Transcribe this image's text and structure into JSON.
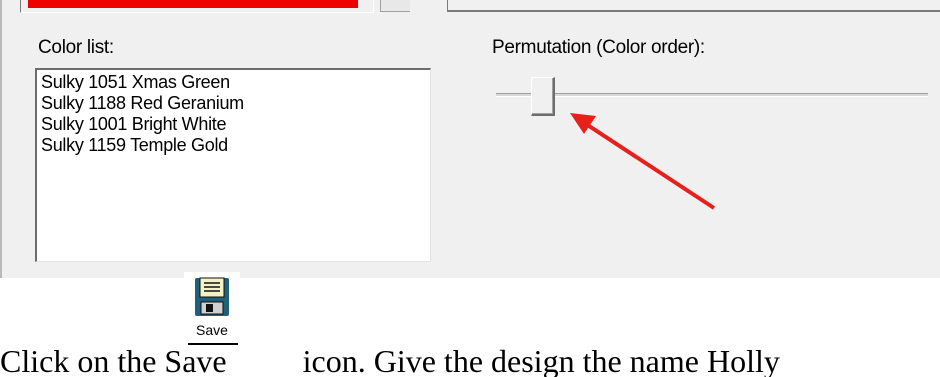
{
  "dialog": {
    "color_list_label": "Color list:",
    "color_list_items": [
      "Sulky 1051 Xmas Green",
      "Sulky 1188 Red Geranium",
      "Sulky 1001 Bright White",
      "Sulky 1159 Temple Gold"
    ],
    "permutation_label": "Permutation (Color order):",
    "permutation_slider_value": 0.1,
    "swatch_color": "#ee0000"
  },
  "annotation": {
    "arrow_color": "#e8201c"
  },
  "instruction": {
    "before": "Click on the Save",
    "after": "icon. Give the design the name Holly",
    "save_icon_label": "Save",
    "save_icon": "floppy-disk-icon"
  }
}
